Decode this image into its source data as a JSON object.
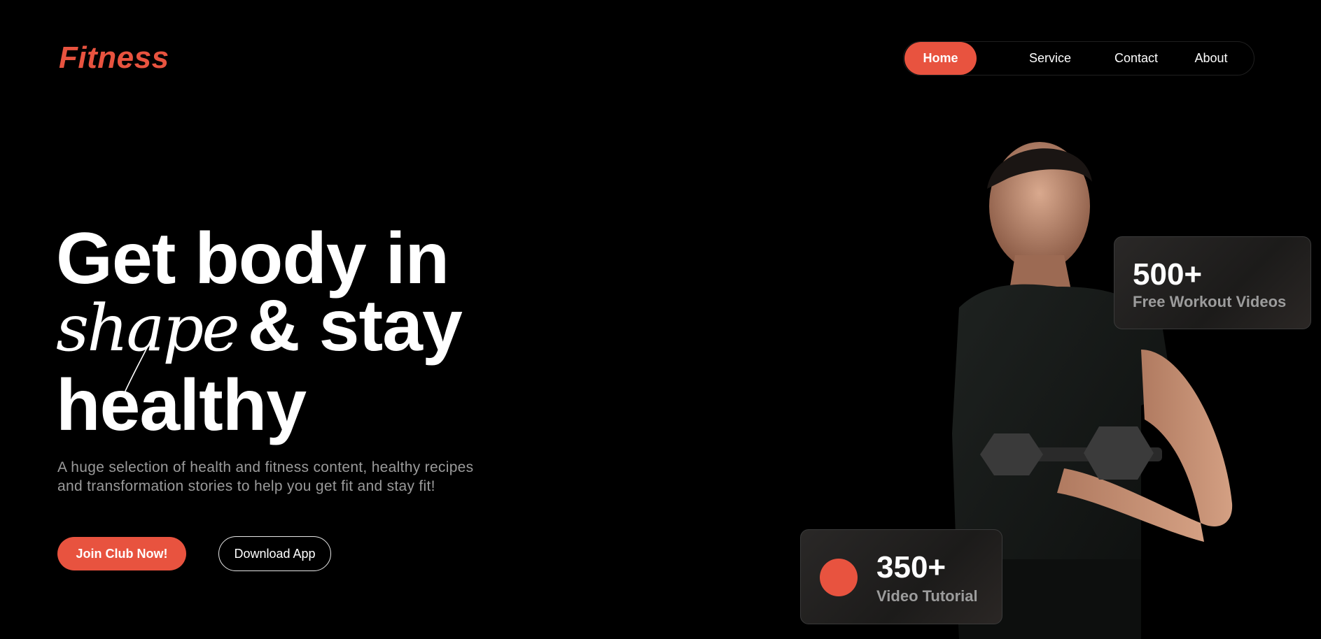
{
  "brand": {
    "logo_text": "Fitness",
    "accent_color": "#e8533f",
    "background_color": "#000000"
  },
  "nav": {
    "items": [
      {
        "label": "Home",
        "active": true
      },
      {
        "label": "Service",
        "active": false
      },
      {
        "label": "Contact",
        "active": false
      },
      {
        "label": "About",
        "active": false
      }
    ]
  },
  "hero": {
    "line1": "Get body in",
    "script_word": "shape",
    "line2_rest": "& stay",
    "line3": "healthy",
    "subtitle_line1": "A huge selection of health and fitness content, healthy recipes",
    "subtitle_line2": "and transformation stories to help you get fit and stay fit!",
    "primary_button": "Join Club Now!",
    "secondary_button": "Download App",
    "image": "man-with-dumbbell-photo"
  },
  "stats": [
    {
      "number": "500+",
      "label": "Free Workout Videos"
    },
    {
      "number": "350+",
      "label": "Video Tutorial"
    }
  ]
}
